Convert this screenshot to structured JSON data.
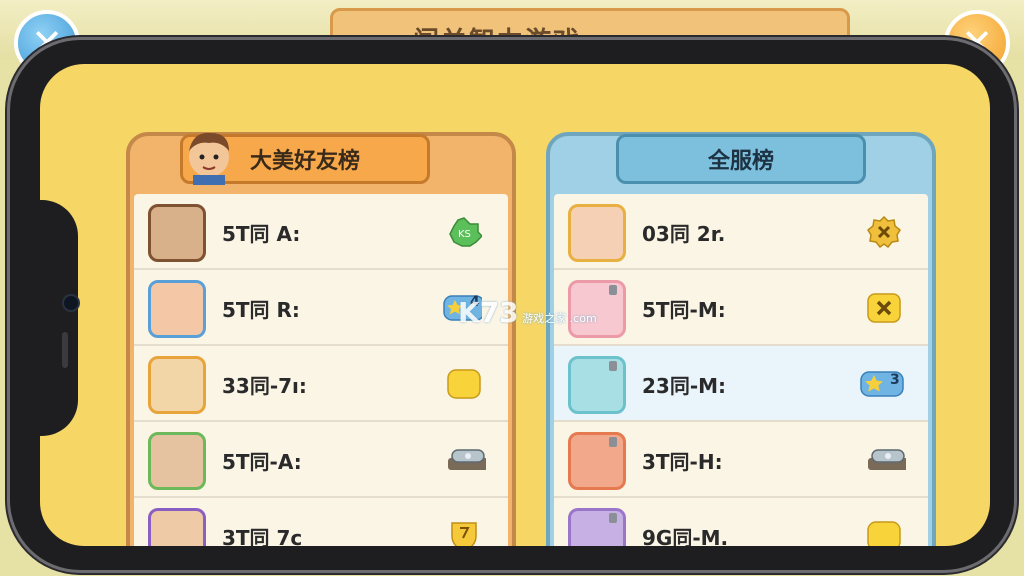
{
  "top_title": "闯关智力游戏",
  "left_panel": {
    "title": "大美好友榜",
    "rows": [
      {
        "label": "5T同 A:",
        "avatar_color": "#7f5232",
        "badge": "green-flower"
      },
      {
        "label": "5T同 R:",
        "avatar_color": "#5aa0d8",
        "badge": "star-4"
      },
      {
        "label": "33同-7ı:",
        "avatar_color": "#e8a43a",
        "badge": "yellow-gem"
      },
      {
        "label": "5T同-A:",
        "avatar_color": "#6cb85a",
        "badge": "chest"
      },
      {
        "label": "3T同 7c",
        "avatar_color": "#8a5fc2",
        "badge": "shield"
      }
    ]
  },
  "right_panel": {
    "title": "全服榜",
    "rows": [
      {
        "label": "03同 2r.",
        "avatar_color": "#e8b040",
        "badge": "gold-gear"
      },
      {
        "label": "5T同-M:",
        "avatar_color": "#ec9aa8",
        "badge": "x-tile"
      },
      {
        "label": "23同-M:",
        "avatar_color": "#6cc2cc",
        "badge": "star-3"
      },
      {
        "label": "3T同-H:",
        "avatar_color": "#e57a50",
        "badge": "chest"
      },
      {
        "label": "9G同-M.",
        "avatar_color": "#9a76c8",
        "badge": "yellow-gem"
      }
    ]
  },
  "badges": {
    "star_4": "4",
    "star_3": "3"
  },
  "watermark": {
    "k": "K73",
    "text": "游戏之家",
    "url": ".com"
  },
  "colors": {
    "screen_bg": "#f6d766",
    "left_header": "#f7a84a",
    "right_header": "#7cc0dd"
  }
}
